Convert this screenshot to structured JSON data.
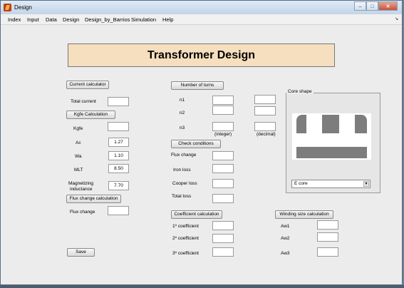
{
  "window": {
    "title": "Design"
  },
  "menu": [
    "Index",
    "Input",
    "Data",
    "Design",
    "Design_by_Barrios",
    "Simulation",
    "Help"
  ],
  "header": {
    "title": "Transformer Design"
  },
  "left": {
    "current_calc_btn": "Current calculator",
    "total_current_label": "Total current",
    "total_current_value": "",
    "kgfe_calc_btn": "Kgfe Calculation",
    "kgfe_label": "Kgfe",
    "kgfe_value": "",
    "ac_label": "Ac",
    "ac_value": "1.27",
    "wa_label": "Wa",
    "wa_value": "1.10",
    "mlt_label": "MLT",
    "mlt_value": "8.50",
    "mag_ind_label_1": "Magnetizing",
    "mag_ind_label_2": "inductance",
    "mag_ind_value": "7.70",
    "flux_calc_btn": "Flux change calculation",
    "flux_change_label": "Flux change",
    "flux_change_value": "",
    "save_btn": "Save"
  },
  "middle": {
    "turns_btn": "Number of turns",
    "n1_label": "n1",
    "n2_label": "n2",
    "n3_label": "n3",
    "integer_label": "(integer)",
    "decimal_label": "(decimal)",
    "check_btn": "Check conditions",
    "flux_change_label": "Flux change",
    "iron_loss_label": "Iron loss",
    "copper_loss_label": "Cooper loss",
    "total_loss_label": "Total loss",
    "coef_btn": "Coefficient calculation",
    "coef1_label": "1º coefficient",
    "coef2_label": "2º coefficient",
    "coef3_label": "3º coefficient"
  },
  "right": {
    "core_shape_label": "Core shape",
    "core_select_value": "E core",
    "winding_btn": "Winding size calculation",
    "aw1_label": "Aw1",
    "aw2_label": "Aw2",
    "aw3_label": "Aw3"
  },
  "icons": {
    "app": "matlab-icon",
    "minimize": "minimize-icon",
    "maximize": "maximize-icon",
    "close": "close-icon",
    "dropdown": "chevron-down-icon"
  }
}
